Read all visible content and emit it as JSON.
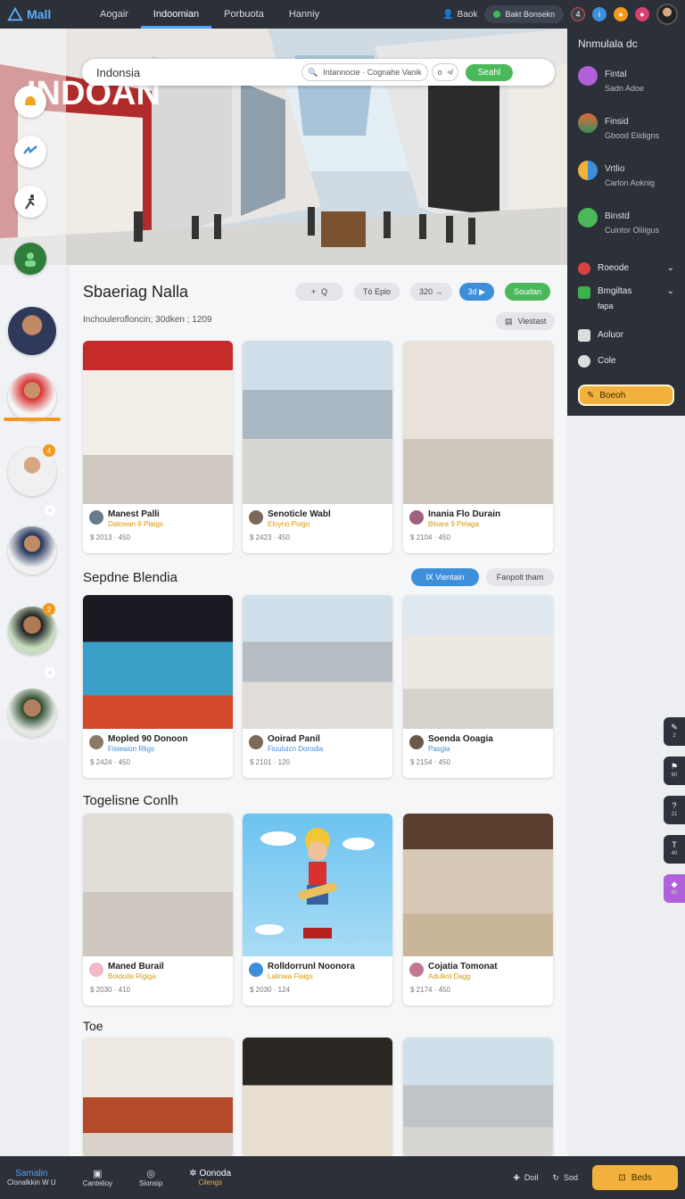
{
  "app": {
    "logo": "Mall"
  },
  "nav": {
    "tabs": [
      "Aogair",
      "Indoomian",
      "Porbuota",
      "Hanniy"
    ],
    "active": 1
  },
  "top_right": {
    "user_link": "Baok",
    "status": "Bakt Bonsekn",
    "notify_count": "4"
  },
  "search": {
    "value": "Indonsia",
    "filter_text": "Intannocie · Cognahe Vanik",
    "count": "o",
    "count_right": "≉",
    "button": "Seahl"
  },
  "right_panel": {
    "title": "Nnmulala dc",
    "items": [
      {
        "label": "Fintal",
        "sub": "Sadn Adoe",
        "color": "#b060d8"
      },
      {
        "label": "Finsid",
        "sub": "Gbood Eiidigns",
        "color": "#e06a3c"
      },
      {
        "label": "Vrtlio",
        "sub": "Carlon Aoknig",
        "color": "#f2b13c"
      },
      {
        "label": "Binstd",
        "sub": "Cuintor Oliiigus",
        "color": "#4bb85a"
      }
    ],
    "rows": [
      {
        "label": "Roeode",
        "chevron": true,
        "color": "#d94040"
      },
      {
        "label": "Bmgiltas",
        "sub": "fapa",
        "chevron": true,
        "color": "#3fb04f"
      },
      {
        "label": "Aoluor",
        "chevron": false,
        "color": "#dddddd"
      },
      {
        "label": "Cole",
        "chevron": false,
        "color": "#dddddd"
      }
    ],
    "cta": "Boeoh"
  },
  "sections": [
    {
      "title": "Sbaeriag Nalla",
      "subline": "Inchoulerofloncin; 30dken ; 1209",
      "toolbar": [
        "+",
        "Q",
        "Tó Epio",
        "320 →",
        "3d ▶",
        "Soudan"
      ],
      "extra": "Viestast",
      "cards": [
        {
          "title": "Manest Palli",
          "sub": "Dalowan 9 Plaigs",
          "meta": "$ 2013 · 450"
        },
        {
          "title": "Senoticle Wabl",
          "sub": "Eloyno Poigo",
          "meta": "$ 2423 · 450"
        },
        {
          "title": "Inania Flo Durain",
          "sub": "Bloara 9 Pelaga",
          "meta": "$ 2104 · 450"
        }
      ]
    },
    {
      "title": "Sepdne Blendia",
      "toolbar": [
        "Ⅸ Vientain",
        "Fanpolt tham"
      ],
      "cards": [
        {
          "title": "Mopled 90 Donoon",
          "sub": "Fisieaion Rligs",
          "meta": "$ 2424 · 450"
        },
        {
          "title": "Ooirad Panil",
          "sub": "Fiuuluicn Dorodia",
          "meta": "$ 2101 · 120"
        },
        {
          "title": "Soenda Ooagia",
          "sub": "Pasgia",
          "meta": "$ 2154 · 450"
        }
      ]
    },
    {
      "title": "Togelisne Conlh",
      "cards": [
        {
          "title": "Maned Burail",
          "sub": "Boidoite Rigiga",
          "meta": "$ 2030 · 410"
        },
        {
          "title": "Rolldorrunl Noonora",
          "sub": "Lalinwa Flaigs",
          "meta": "$ 2030 · 124"
        },
        {
          "title": "Cojatia Tomonat",
          "sub": "Adulkol Dagg",
          "meta": "$ 2174 · 450"
        }
      ]
    },
    {
      "title": "Toe"
    }
  ],
  "fabs": [
    {
      "icon": "✎",
      "n": "2"
    },
    {
      "icon": "⚑",
      "n": "60"
    },
    {
      "icon": "?",
      "n": "21"
    },
    {
      "icon": "T",
      "n": "40"
    },
    {
      "icon": "◆",
      "n": "60"
    }
  ],
  "bottom": {
    "items": [
      {
        "label": "Samalin",
        "sub": "Clonalkkin W U"
      },
      {
        "label": "▣",
        "sub": "Cantelioy"
      },
      {
        "label": "◎",
        "sub": "Sionsip"
      },
      {
        "label": "✲ Oonoda",
        "sub": "Cilengs"
      }
    ],
    "link1": "Doil",
    "link2": "Sod",
    "button": "Beds"
  },
  "colors": {
    "accent": "#4ba3ff",
    "bar": "#2c3038",
    "orange": "#f2b13c",
    "green": "#4bb85a"
  }
}
